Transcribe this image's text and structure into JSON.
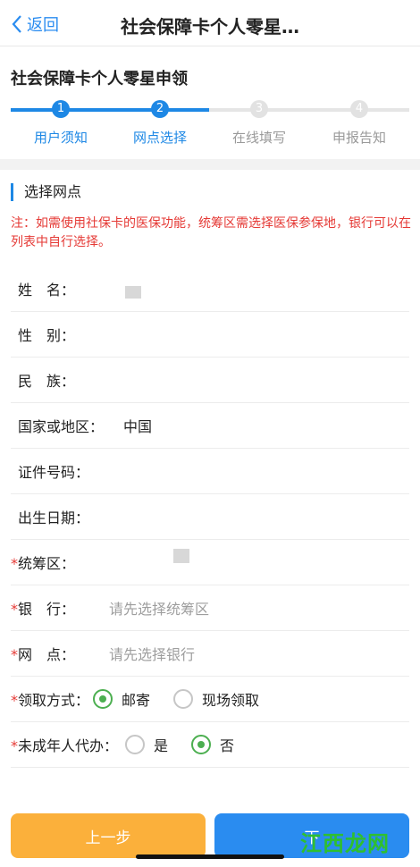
{
  "nav": {
    "back_label": "返回",
    "title": "社会保障卡个人零星…"
  },
  "header": {
    "title": "社会保障卡个人零星申领"
  },
  "steps": [
    {
      "num": "1",
      "label": "用户须知",
      "state": "done"
    },
    {
      "num": "2",
      "label": "网点选择",
      "state": "current"
    },
    {
      "num": "3",
      "label": "在线填写",
      "state": "todo"
    },
    {
      "num": "4",
      "label": "申报告知",
      "state": "todo"
    }
  ],
  "section": {
    "title": "选择网点",
    "notice": "注：如需使用社保卡的医保功能，统筹区需选择医保参保地，银行可以在列表中自行选择。"
  },
  "fields": {
    "name": {
      "label": "姓　名：",
      "value": ""
    },
    "gender": {
      "label": "性　别：",
      "value": ""
    },
    "ethnicity": {
      "label": "民　族：",
      "value": ""
    },
    "country": {
      "label": "国家或地区：",
      "value": "中国"
    },
    "id_number": {
      "label": "证件号码：",
      "value": ""
    },
    "birth_date": {
      "label": "出生日期：",
      "value": ""
    },
    "region": {
      "required": "*",
      "label": "统筹区：",
      "value": ""
    },
    "bank": {
      "required": "*",
      "label": "银　行：",
      "placeholder": "请先选择统筹区"
    },
    "branch": {
      "required": "*",
      "label": "网　点：",
      "placeholder": "请先选择银行"
    },
    "pickup": {
      "required": "*",
      "label": "领取方式：",
      "options": [
        "邮寄",
        "现场领取"
      ],
      "selected": "邮寄"
    },
    "minor_proxy": {
      "required": "*",
      "label": "未成年人代办：",
      "options": [
        "是",
        "否"
      ],
      "selected": "否"
    }
  },
  "buttons": {
    "prev": "上一步",
    "next": "下"
  },
  "watermark": "江西龙网",
  "colors": {
    "accent": "#1e88e5",
    "required": "#e53935",
    "radio_on": "#4caf50",
    "prev_btn": "#fbb03b",
    "next_btn": "#2a8cf0"
  },
  "icons": {
    "back": "chevron-left-icon"
  }
}
